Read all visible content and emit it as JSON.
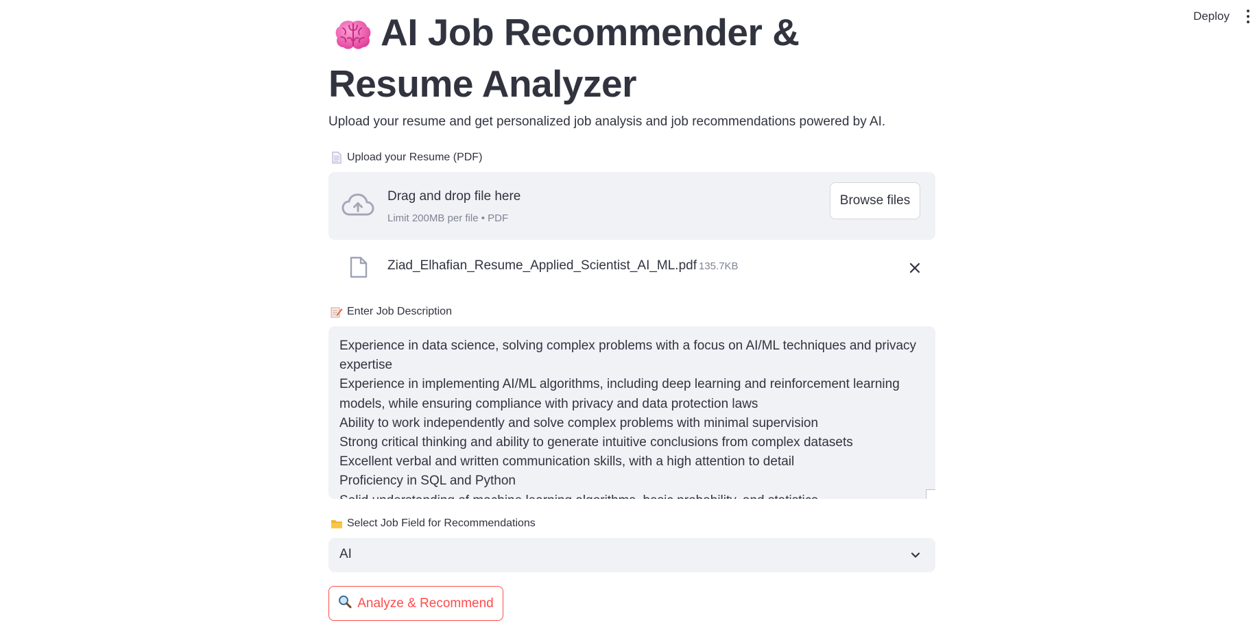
{
  "header": {
    "deploy_label": "Deploy",
    "menu_icon": "kebab-menu-icon"
  },
  "page": {
    "title": "AI Job Recommender & Resume Analyzer",
    "title_icon": "brain-emoji",
    "subtitle": "Upload your resume and get personalized job analysis and job recommendations powered by AI."
  },
  "upload": {
    "label": "Upload your Resume (PDF)",
    "label_icon": "page-facing-up-emoji",
    "dropzone_title": "Drag and drop file here",
    "dropzone_limit": "Limit 200MB per file • PDF",
    "browse_label": "Browse files",
    "file": {
      "name": "Ziad_Elhafian_Resume_Applied_Scientist_AI_ML.pdf",
      "size": "135.7KB"
    }
  },
  "job_description": {
    "label": "Enter Job Description",
    "label_icon": "memo-emoji",
    "value": "Experience in data science, solving complex problems with a focus on AI/ML techniques and privacy expertise\nExperience in implementing AI/ML algorithms, including deep learning and reinforcement learning models, while ensuring compliance with privacy and data protection laws\nAbility to work independently and solve complex problems with minimal supervision\nStrong critical thinking and ability to generate intuitive conclusions from complex datasets\nExcellent verbal and written communication skills, with a high attention to detail\nProficiency in SQL and Python\nSolid understanding of machine learning algorithms, basic probability, and statistics"
  },
  "job_field": {
    "label": "Select Job Field for Recommendations",
    "label_icon": "folder-emoji",
    "selected": "AI"
  },
  "actions": {
    "analyze_label": "Analyze & Recommend",
    "analyze_icon": "magnifier-emoji"
  },
  "colors": {
    "primary": "#ff4b4b",
    "text": "#31333f",
    "muted": "#808495",
    "input_bg": "#f0f2f6"
  }
}
